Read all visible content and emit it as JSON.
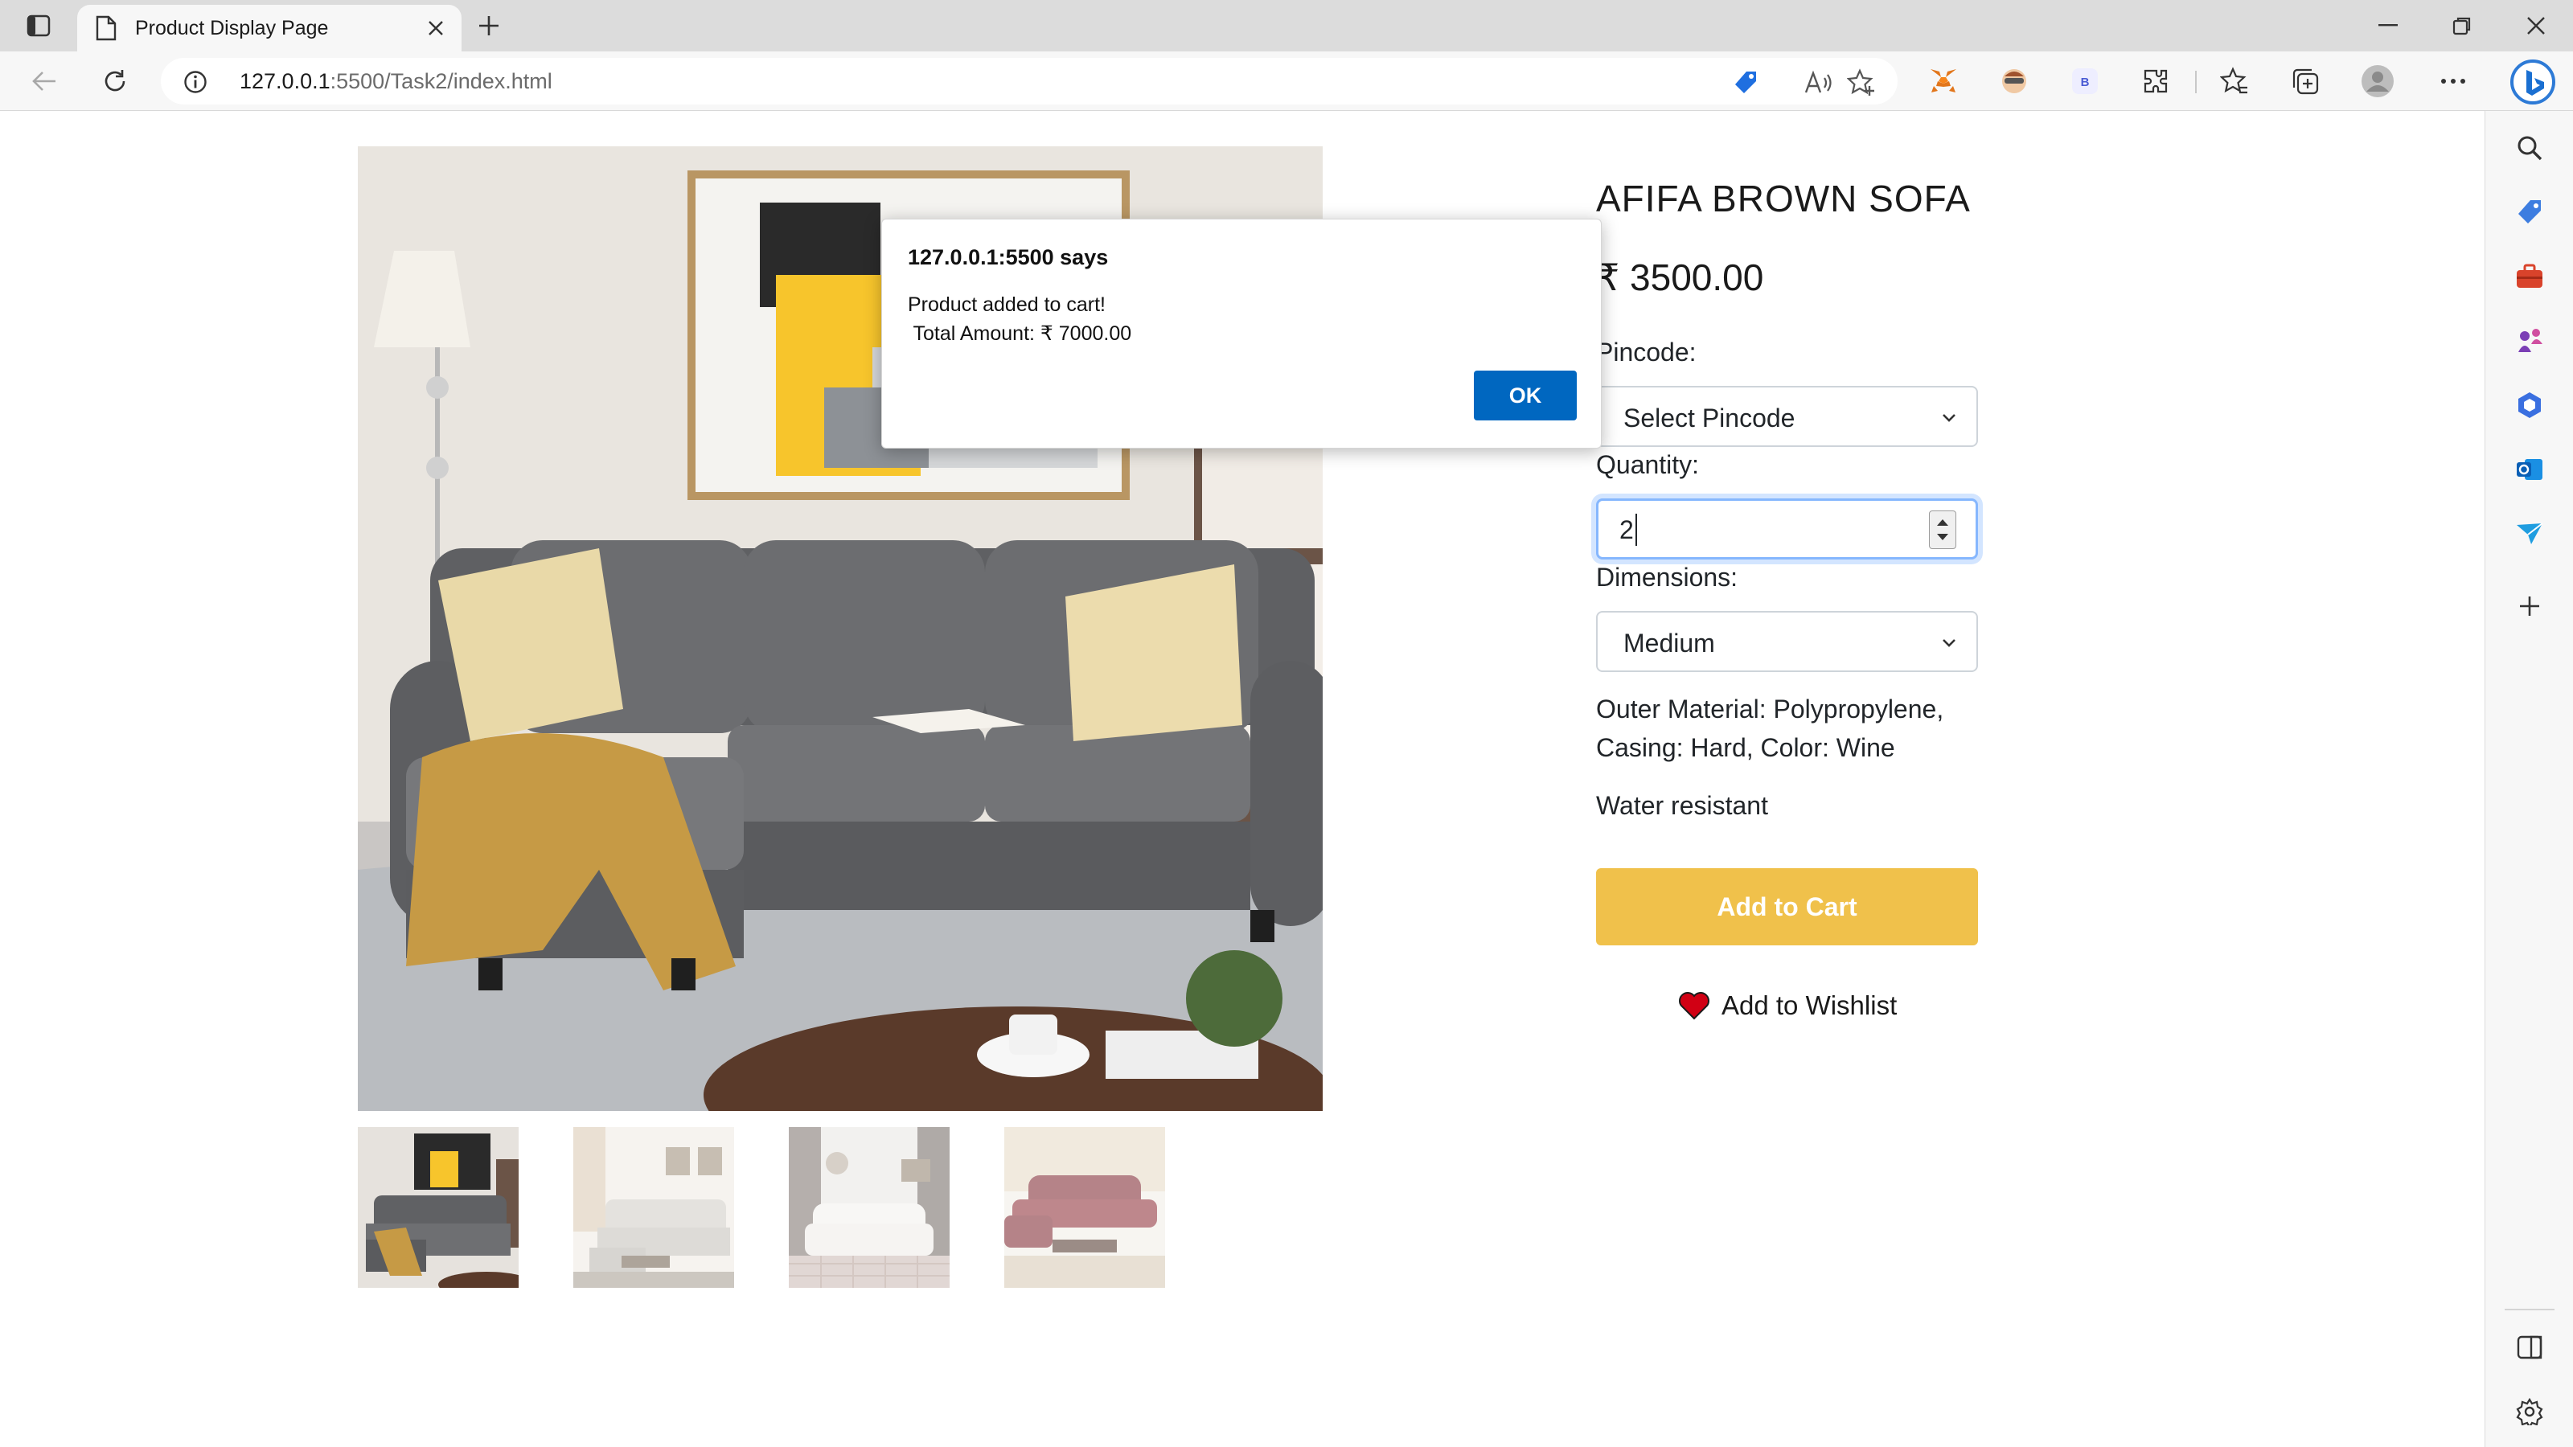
{
  "browser": {
    "tab_title": "Product Display Page",
    "url_host": "127.0.0.1",
    "url_rest": ":5500/Task2/index.html"
  },
  "product": {
    "title": "AFIFA BROWN SOFA",
    "price": "₹ 3500.00",
    "pincode_label": "Pincode:",
    "pincode_value": "Select Pincode",
    "quantity_label": "Quantity:",
    "quantity_value": "2",
    "dimensions_label": "Dimensions:",
    "dimensions_value": "Medium",
    "description": "Outer Material: Polypropylene, Casing: Hard, Color: Wine",
    "feature": "Water resistant",
    "add_to_cart": "Add to Cart",
    "add_to_wishlist": "Add to Wishlist"
  },
  "thumbnails": [
    {
      "name": "grey-sectional-sofa",
      "selected": true
    },
    {
      "name": "beige-sectional-sofa",
      "selected": false
    },
    {
      "name": "white-tufted-sofa",
      "selected": false
    },
    {
      "name": "maroon-sofa-set",
      "selected": false
    }
  ],
  "dialog": {
    "title": "127.0.0.1:5500 says",
    "message": "Product added to cart!\n Total Amount: ₹ 7000.00",
    "ok_label": "OK"
  },
  "colors": {
    "cart_button": "#f0c14b",
    "dialog_ok": "#0067c0",
    "wishlist_heart": "#d10014"
  }
}
